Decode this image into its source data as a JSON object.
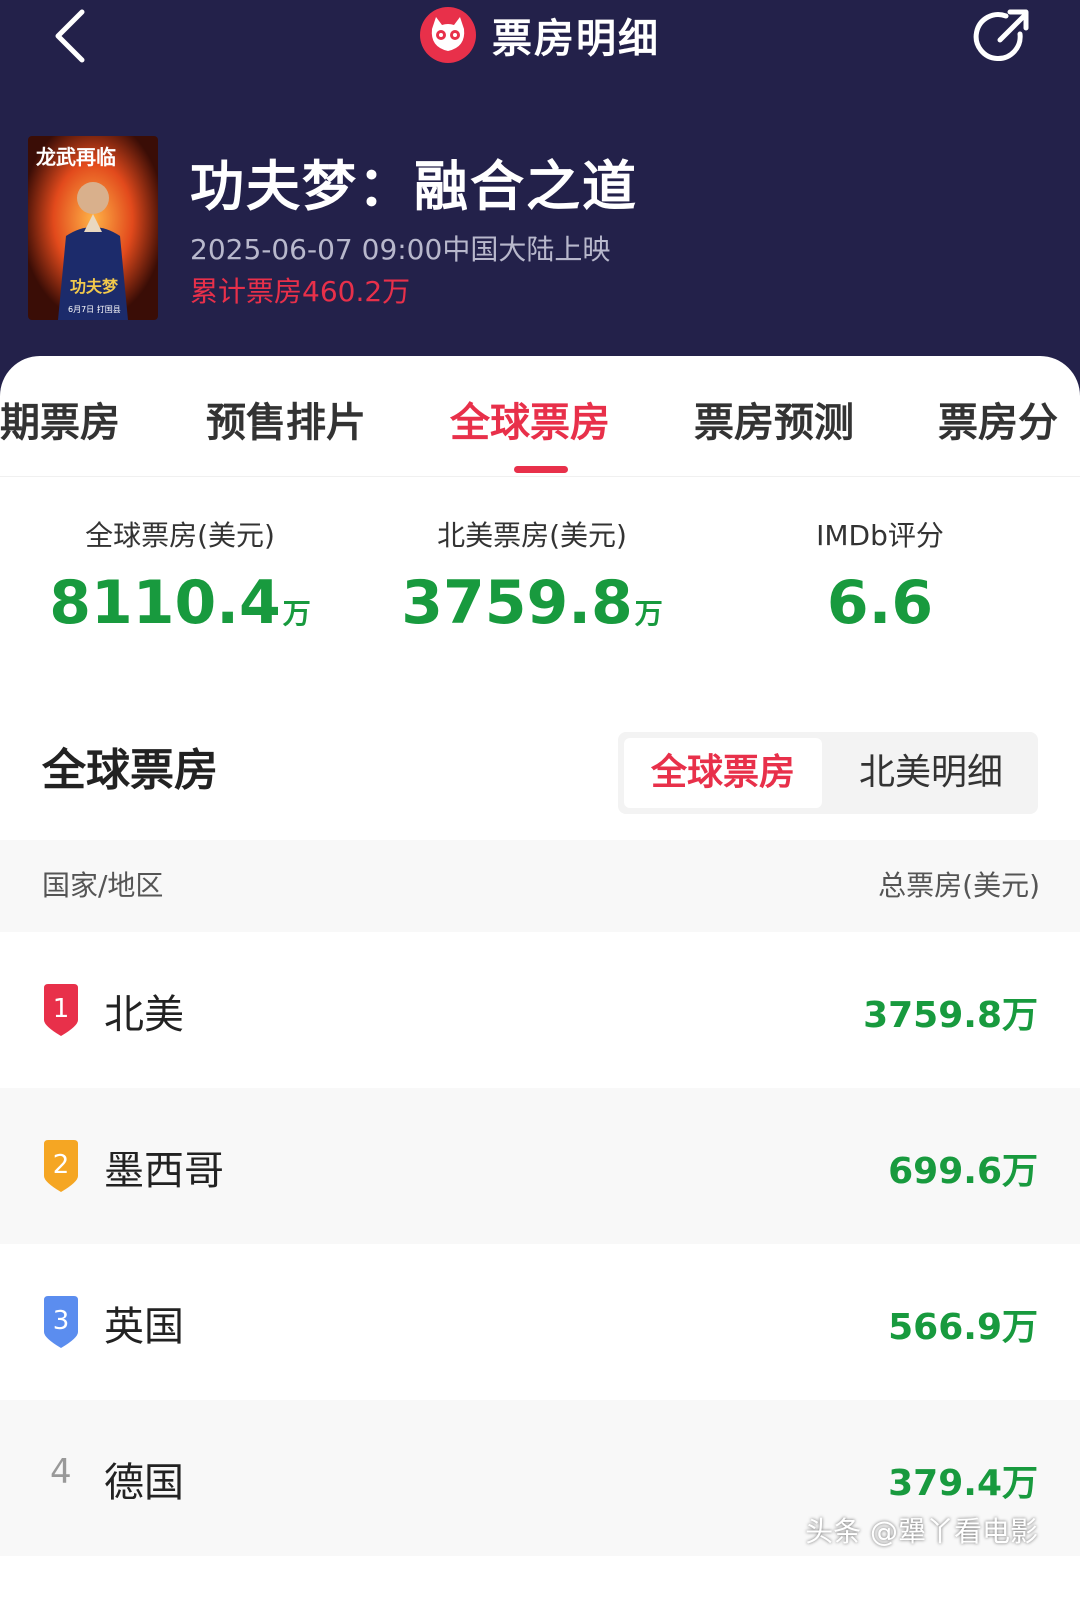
{
  "nav": {
    "title": "票房明细"
  },
  "movie": {
    "title": "功夫梦：融合之道",
    "release": "2025-06-07 09:00中国大陆上映",
    "cumulative": "累计票房460.2万",
    "poster_text": {
      "top": "龙武再临",
      "mid": "功夫梦",
      "date": "6月7日 打国县"
    }
  },
  "tabs": [
    "期票房",
    "预售排片",
    "全球票房",
    "票房预测",
    "票房分"
  ],
  "active_tab": "全球票房",
  "stats": [
    {
      "label": "全球票房(美元)",
      "value": "8110.4",
      "unit": "万"
    },
    {
      "label": "北美票房(美元)",
      "value": "3759.8",
      "unit": "万"
    },
    {
      "label": "IMDb评分",
      "value": "6.6",
      "unit": ""
    }
  ],
  "section": {
    "title": "全球票房",
    "segments": [
      "全球票房",
      "北美明细"
    ]
  },
  "table": {
    "col_left": "国家/地区",
    "col_right": "总票房(美元)",
    "rows": [
      {
        "rank": "1",
        "region": "北美",
        "gross": "3759.8万",
        "badge_color": "#e8304a"
      },
      {
        "rank": "2",
        "region": "墨西哥",
        "gross": "699.6万",
        "badge_color": "#f5a623"
      },
      {
        "rank": "3",
        "region": "英国",
        "gross": "566.9万",
        "badge_color": "#5b8def"
      },
      {
        "rank": "4",
        "region": "德国",
        "gross": "379.4万",
        "badge_color": ""
      }
    ]
  },
  "watermark": "头条 @犟丫看电影",
  "colors": {
    "header_bg": "#23214a",
    "accent": "#e8304a",
    "value_green": "#189a3e"
  }
}
